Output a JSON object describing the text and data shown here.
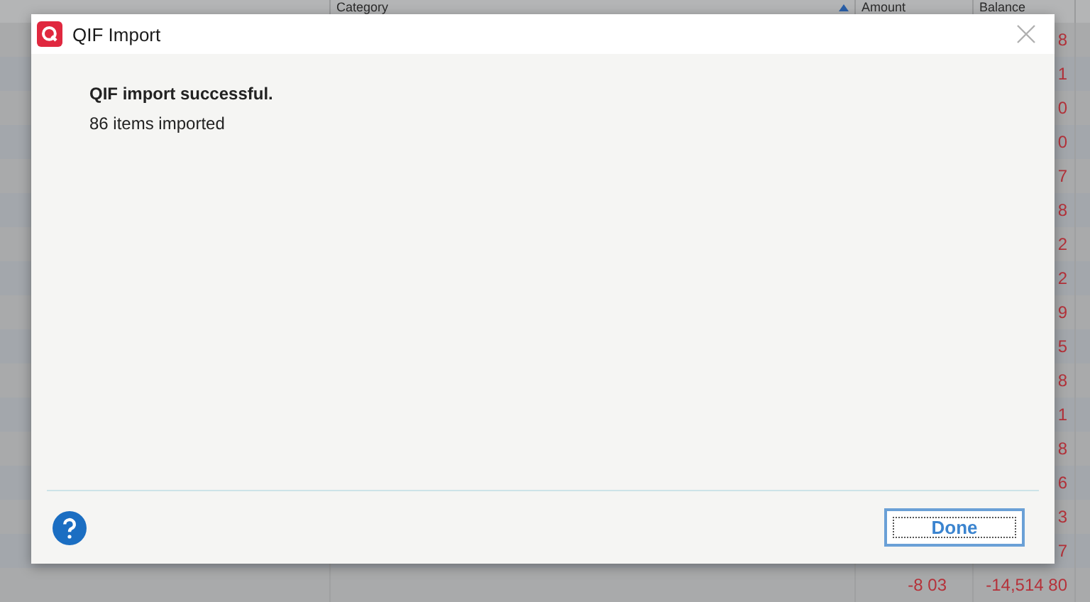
{
  "background_table": {
    "columns": [
      {
        "label": "Category",
        "sorted": true
      },
      {
        "label": "Amount",
        "sorted": false
      },
      {
        "label": "Balance",
        "sorted": false
      }
    ],
    "rows": [
      {
        "balance": "8"
      },
      {
        "balance": "1"
      },
      {
        "balance": "0"
      },
      {
        "balance": "0"
      },
      {
        "balance": "7"
      },
      {
        "balance": "8"
      },
      {
        "balance": "2"
      },
      {
        "balance": "2"
      },
      {
        "balance": "9"
      },
      {
        "balance": "5"
      },
      {
        "balance": "8"
      },
      {
        "balance": "1"
      },
      {
        "balance": "8"
      },
      {
        "balance": "6"
      },
      {
        "balance": "3"
      },
      {
        "balance": "7"
      },
      {
        "amount": "-8 03",
        "balance": "-14,514 80"
      }
    ]
  },
  "dialog": {
    "title": "QIF Import",
    "heading": "QIF import successful.",
    "message": "86 items imported",
    "buttons": [
      {
        "label": "Done",
        "focused": true
      }
    ]
  }
}
